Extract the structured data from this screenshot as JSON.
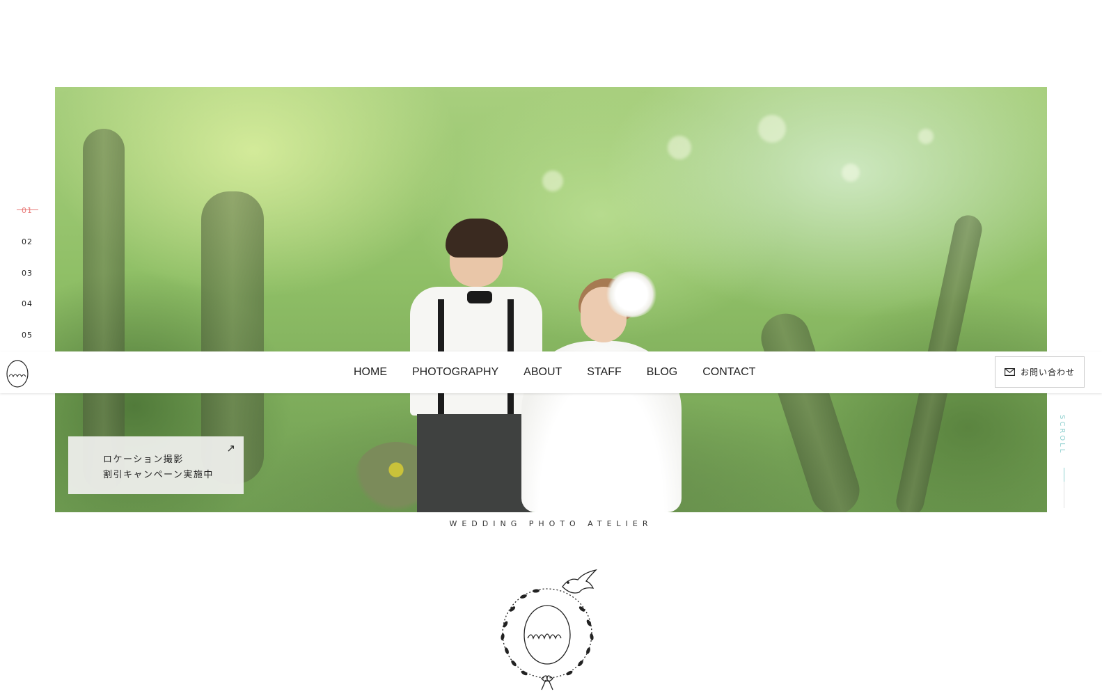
{
  "slides": {
    "items": [
      "01",
      "02",
      "03",
      "04",
      "05"
    ],
    "active_index": 0
  },
  "nav": {
    "items": [
      {
        "label": "HOME",
        "active": true
      },
      {
        "label": "PHOTOGRAPHY",
        "active": false
      },
      {
        "label": "ABOUT",
        "active": false
      },
      {
        "label": "STAFF",
        "active": false
      },
      {
        "label": "BLOG",
        "active": false
      },
      {
        "label": "CONTACT",
        "active": false
      }
    ],
    "contact_button": "お問い合わせ",
    "contact_icon": "mail-icon"
  },
  "campaign": {
    "line1": "ロケーション撮影",
    "line2": "割引キャンペーン実施中",
    "arrow": "↗"
  },
  "scroll": {
    "label": "SCROLL"
  },
  "tagline": "WEDDING PHOTO ATELIER",
  "colors": {
    "accent_active": "#e87a78",
    "scroll_accent": "#8fd0cf"
  }
}
